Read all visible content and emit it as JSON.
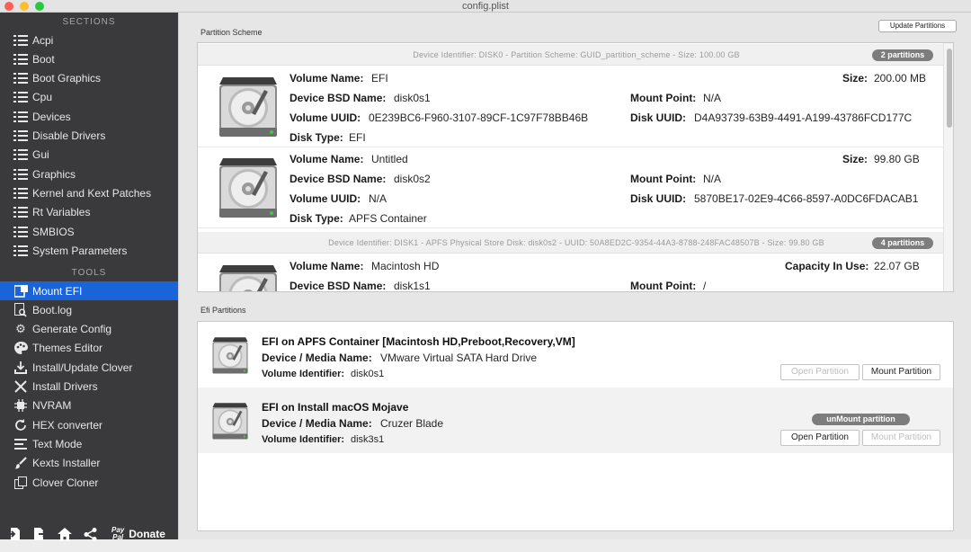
{
  "window": {
    "title": "config.plist"
  },
  "sidebar": {
    "sections_label": "SECTIONS",
    "sections": [
      {
        "label": "Acpi",
        "icon": "list-icon"
      },
      {
        "label": "Boot",
        "icon": "list-icon"
      },
      {
        "label": "Boot Graphics",
        "icon": "list-icon"
      },
      {
        "label": "Cpu",
        "icon": "list-icon"
      },
      {
        "label": "Devices",
        "icon": "list-icon"
      },
      {
        "label": "Disable Drivers",
        "icon": "list-icon"
      },
      {
        "label": "Gui",
        "icon": "list-icon"
      },
      {
        "label": "Graphics",
        "icon": "list-icon"
      },
      {
        "label": "Kernel and Kext Patches",
        "icon": "list-icon"
      },
      {
        "label": "Rt Variables",
        "icon": "list-icon"
      },
      {
        "label": "SMBIOS",
        "icon": "list-icon"
      },
      {
        "label": "System Parameters",
        "icon": "list-icon"
      }
    ],
    "tools_label": "TOOLS",
    "tools": [
      {
        "label": "Mount EFI",
        "icon": "mount-icon",
        "selected": true
      },
      {
        "label": "Boot.log",
        "icon": "log-search-icon"
      },
      {
        "label": "Generate Config",
        "icon": "gears-icon"
      },
      {
        "label": "Themes Editor",
        "icon": "palette-icon"
      },
      {
        "label": "Install/Update Clover",
        "icon": "download-icon"
      },
      {
        "label": "Install Drivers",
        "icon": "tools-icon"
      },
      {
        "label": "NVRAM",
        "icon": "chip-icon"
      },
      {
        "label": "HEX converter",
        "icon": "refresh-icon"
      },
      {
        "label": "Text Mode",
        "icon": "text-icon"
      },
      {
        "label": "Kexts Installer",
        "icon": "brush-icon"
      },
      {
        "label": "Clover Cloner",
        "icon": "copy-icon"
      }
    ],
    "bottom": {
      "paypal_top": "Pay",
      "paypal_bottom": "Pal",
      "donate_label": "Donate"
    }
  },
  "partition_scheme": {
    "group_label": "Partition Scheme",
    "update_button": "Update Partitions",
    "disk0": {
      "header": "Device Identifier: DISK0 - Partition Scheme: GUID_partition_scheme - Size: 100.00 GB",
      "badge": "2 partitions"
    },
    "disk1": {
      "header": "Device Identifier: DISK1 - APFS Physical Store Disk: disk0s2 - UUID: 50A8ED2C-9354-44A3-8788-248FAC48507B - Size: 99.80 GB",
      "badge": "4 partitions"
    },
    "labels": {
      "volume_name": "Volume Name:",
      "device_bsd": "Device BSD Name:",
      "volume_uuid": "Volume UUID:",
      "disk_type": "Disk Type:",
      "size": "Size:",
      "mount_point": "Mount Point:",
      "disk_uuid": "Disk UUID:",
      "capacity": "Capacity In Use:"
    },
    "volumes": [
      {
        "volume_name": "EFI",
        "device_bsd": "disk0s1",
        "volume_uuid": "0E239BC6-F960-3107-89CF-1C97F78BB46B",
        "disk_type": "EFI",
        "size": "200.00 MB",
        "mount_point": "N/A",
        "disk_uuid": "D4A93739-63B9-4491-A199-43786FCD177C"
      },
      {
        "volume_name": "Untitled",
        "device_bsd": "disk0s2",
        "volume_uuid": "N/A",
        "disk_type": "APFS Container",
        "size": "99.80 GB",
        "mount_point": "N/A",
        "disk_uuid": "5870BE17-02E9-4C66-8597-A0DC6FDACAB1"
      },
      {
        "volume_name": "Macintosh HD",
        "device_bsd": "disk1s1",
        "capacity": "22.07 GB",
        "mount_point": "/"
      }
    ]
  },
  "efi_partitions": {
    "group_label": "Efi Partitions",
    "labels": {
      "device_media": "Device / Media Name:",
      "volume_identifier": "Volume Identifier:"
    },
    "items": [
      {
        "title": "EFI on APFS Container [Macintosh HD,Preboot,Recovery,VM]",
        "device_media": "VMware Virtual SATA Hard Drive",
        "volume_identifier": "disk0s1",
        "open_button": "Open Partition",
        "mount_button": "Mount Partition"
      },
      {
        "title": "EFI on Install macOS Mojave",
        "device_media": "Cruzer Blade",
        "volume_identifier": "disk3s1",
        "status_badge": "unMount partition",
        "open_button": "Open Partition",
        "mount_button": "Mount Partition"
      }
    ]
  },
  "colors": {
    "sidebar_bg": "#3a3a3c",
    "selection": "#1a63d8",
    "badge": "#7d7d7d"
  }
}
